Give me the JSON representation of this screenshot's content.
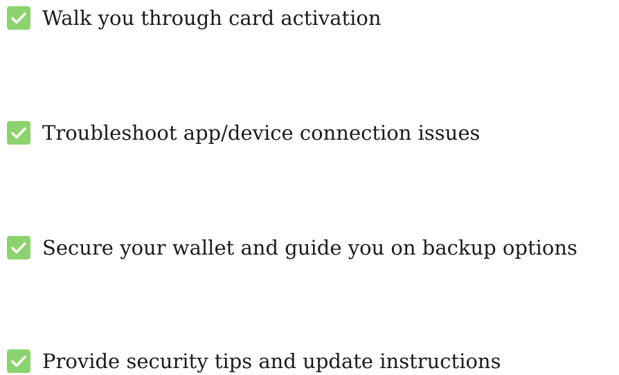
{
  "checklist": {
    "icon": "check-box-icon",
    "icon_color": "#8bd36e",
    "icon_check_color": "#ffffff",
    "items": [
      {
        "label": "Walk you through card activation"
      },
      {
        "label": "Troubleshoot app/device connection issues"
      },
      {
        "label": "Secure your wallet and guide you on backup options"
      },
      {
        "label": "Provide security tips and update instructions"
      }
    ]
  }
}
